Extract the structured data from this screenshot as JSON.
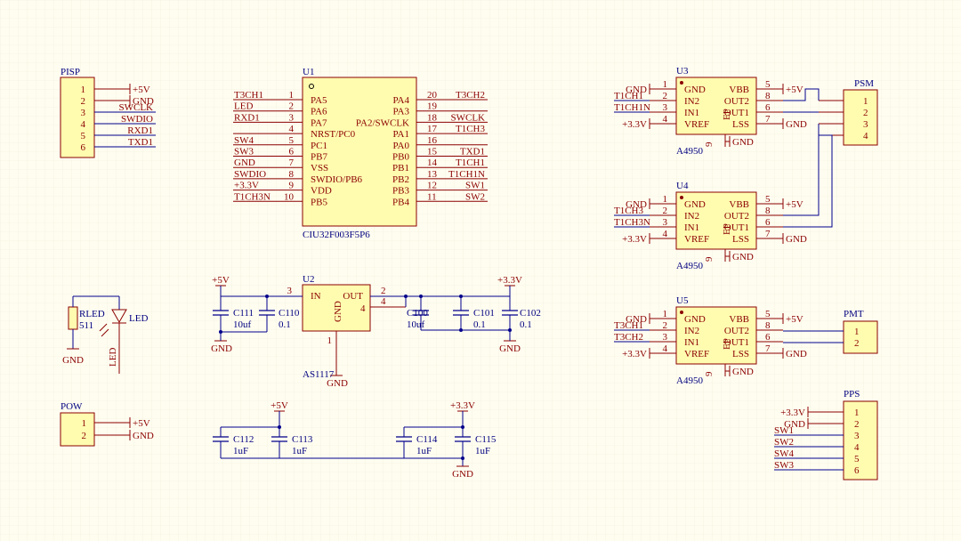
{
  "pisp": {
    "ref": "PISP",
    "pins": [
      "1",
      "2",
      "3",
      "4",
      "5",
      "6"
    ],
    "nets": [
      "+5V",
      "GND",
      "SWCLK",
      "SWDIO",
      "RXD1",
      "TXD1"
    ]
  },
  "u1": {
    "ref": "U1",
    "part": "CIU32F003F5P6",
    "left": [
      [
        "1",
        "PA5",
        "T3CH1"
      ],
      [
        "2",
        "PA6",
        "LED"
      ],
      [
        "3",
        "PA7",
        "RXD1"
      ],
      [
        "4",
        "NRST/PC0",
        ""
      ],
      [
        "5",
        "PC1",
        "SW4"
      ],
      [
        "6",
        "PB7",
        "SW3"
      ],
      [
        "7",
        "VSS",
        "GND"
      ],
      [
        "8",
        "SWDIO/PB6",
        "SWDIO"
      ],
      [
        "9",
        "VDD",
        "+3.3V"
      ],
      [
        "10",
        "PB5",
        "T1CH3N"
      ]
    ],
    "right": [
      [
        "20",
        "PA4",
        "T3CH2"
      ],
      [
        "19",
        "PA3",
        ""
      ],
      [
        "18",
        "PA2/SWCLK",
        "SWCLK"
      ],
      [
        "17",
        "PA1",
        "T1CH3"
      ],
      [
        "16",
        "PA0",
        ""
      ],
      [
        "15",
        "PB0",
        "TXD1"
      ],
      [
        "14",
        "PB1",
        "T1CH1"
      ],
      [
        "13",
        "PB2",
        "T1CH1N"
      ],
      [
        "12",
        "PB3",
        "SW1"
      ],
      [
        "11",
        "PB4",
        "SW2"
      ]
    ]
  },
  "u2": {
    "ref": "U2",
    "part": "AS1117",
    "in": "IN",
    "out": "OUT",
    "gnd": "GND",
    "pin_in": "3",
    "pin_out": "2",
    "pin_gnd": "1",
    "pin_tab": "4"
  },
  "caps_u2": [
    {
      "ref": "C111",
      "val": "10uf"
    },
    {
      "ref": "C110",
      "val": "0.1"
    },
    {
      "ref": "C100",
      "val": "10uf"
    },
    {
      "ref": "C101",
      "val": "0.1"
    },
    {
      "ref": "C102",
      "val": "0.1"
    }
  ],
  "caps_bottom": [
    {
      "ref": "C112",
      "val": "1uF"
    },
    {
      "ref": "C113",
      "val": "1uF"
    },
    {
      "ref": "C114",
      "val": "1uF"
    },
    {
      "ref": "C115",
      "val": "1uF"
    }
  ],
  "power": {
    "p5v": "+5V",
    "p33": "+3.3V",
    "gnd": "GND"
  },
  "led": {
    "r_ref": "RLED",
    "r_val": "511",
    "led_ref": "LED",
    "led_val": "LED"
  },
  "pow": {
    "ref": "POW",
    "pins": [
      "1",
      "2"
    ],
    "nets": [
      "+5V",
      "GND"
    ]
  },
  "drivers": [
    {
      "ref": "U3",
      "part": "A4950",
      "in2": "T1CH1",
      "in1": "T1CH1N"
    },
    {
      "ref": "U4",
      "part": "A4950",
      "in2": "T1CH3",
      "in1": "T1CH3N"
    },
    {
      "ref": "U5",
      "part": "A4950",
      "in2": "T3CH1",
      "in1": "T3CH2"
    }
  ],
  "driver_pins": {
    "left": [
      [
        "1",
        "GND"
      ],
      [
        "2",
        "IN2"
      ],
      [
        "3",
        "IN1"
      ],
      [
        "4",
        "VREF"
      ]
    ],
    "right": [
      [
        "5",
        "VBB"
      ],
      [
        "8",
        "OUT2"
      ],
      [
        "6",
        "OUT1"
      ],
      [
        "7",
        "LSS"
      ]
    ],
    "ep": "EP",
    "ep_pin": "9"
  },
  "psm": {
    "ref": "PSM",
    "pins": [
      "1",
      "2",
      "3",
      "4"
    ]
  },
  "pmt": {
    "ref": "PMT",
    "pins": [
      "1",
      "2"
    ]
  },
  "pps": {
    "ref": "PPS",
    "pins": [
      "1",
      "2",
      "3",
      "4",
      "5",
      "6"
    ],
    "nets": [
      "+3.3V",
      "GND",
      "SW1",
      "SW2",
      "SW4",
      "SW3"
    ]
  }
}
